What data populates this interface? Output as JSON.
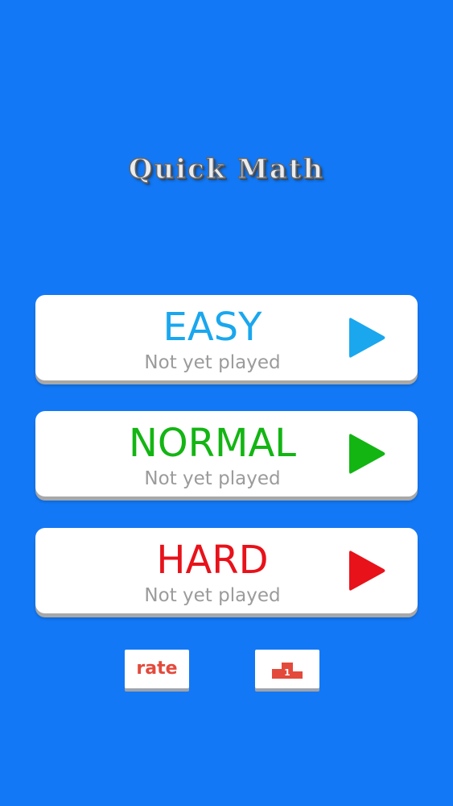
{
  "app": {
    "title": "Quick Math"
  },
  "levels": [
    {
      "id": "easy",
      "name": "EASY",
      "status": "Not yet played",
      "color": "#1aa7ee",
      "icon": "play-icon"
    },
    {
      "id": "normal",
      "name": "NORMAL",
      "status": "Not yet played",
      "color": "#13b513",
      "icon": "play-icon"
    },
    {
      "id": "hard",
      "name": "HARD",
      "status": "Not yet played",
      "color": "#e8121a",
      "icon": "play-icon"
    }
  ],
  "footer": {
    "rate_label": "rate",
    "leaderboard_icon": "podium-icon",
    "leaderboard_rank": "1"
  },
  "colors": {
    "background": "#1378f5",
    "button_accent": "#e34a3c"
  }
}
